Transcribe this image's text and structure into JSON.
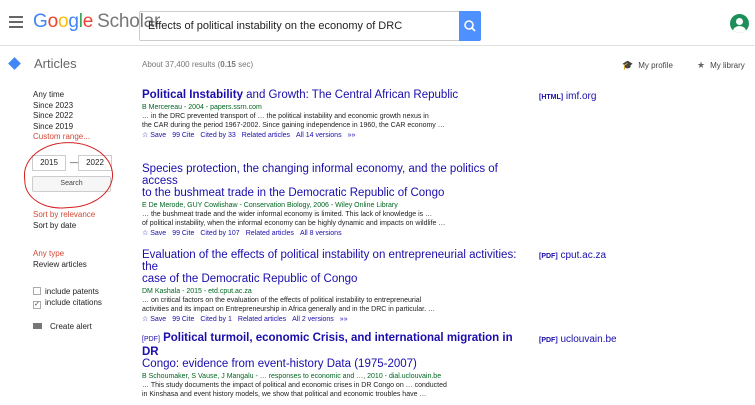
{
  "header": {
    "logo_google": [
      "G",
      "o",
      "o",
      "g",
      "l",
      "e"
    ],
    "logo_scholar": "Scholar",
    "search_value": "Effects of political instability on the economy of DRC"
  },
  "subbar": {
    "section": "Articles",
    "about_prefix": "About 37,400 results (",
    "about_time": "0.15",
    "about_suffix": " sec)",
    "my_profile": "My profile",
    "my_library": "My library"
  },
  "sidebar": {
    "time_filters": [
      "Any time",
      "Since 2023",
      "Since 2022",
      "Since 2019"
    ],
    "custom_range": "Custom range...",
    "year_from": "2015",
    "year_sep": "—",
    "year_to": "2022",
    "search_button": "Search",
    "sort_relevance": "Sort by relevance",
    "sort_date": "Sort by date",
    "any_type": "Any type",
    "review_articles": "Review articles",
    "include_patents": "include patents",
    "include_citations": "include citations",
    "create_alert": "Create alert"
  },
  "results": [
    {
      "title_parts": [
        [
          "Political Instability",
          true
        ],
        [
          " and Growth: The Central African Republic",
          false
        ]
      ],
      "authors": "B Mercereau - 2004 - papers.ssrn.com",
      "snippet1": "… in the DRC prevented transport of … the political instability and economic growth nexus in",
      "snippet2": "the CAR during the period 1967-2002. Since gaining independence in 1960, the CAR economy …",
      "links": [
        "☆ Save",
        "99 Cite",
        "Cited by 33",
        "Related articles",
        "All 14 versions",
        "»»"
      ],
      "side_format": "[HTML]",
      "side_domain": "imf.org"
    },
    {
      "title_line1": "Species protection, the changing informal economy, and the politics of access",
      "title_line2": "to the bushmeat trade in the Democratic Republic of Congo",
      "authors": "E De Merode, GUY Cowlishaw - Conservation Biology, 2006 - Wiley Online Library",
      "snippet1": "… the bushmeat trade and the wider informal economy is limited. This lack of knowledge is …",
      "snippet2": "of political instability, when the informal economy can be highly dynamic and impacts on wildlife …",
      "links": [
        "☆ Save",
        "99 Cite",
        "Cited by 107",
        "Related articles",
        "All 8 versions"
      ]
    },
    {
      "title_line1": "Evaluation of the effects of political instability on entrepreneurial activities: the",
      "title_line2": "case of the Democratic Republic of Congo",
      "authors": "DM Kashala - 2015 - etd.cput.ac.za",
      "snippet1": "… on critical factors on the evaluation of the effects of political instability to entrepreneurial",
      "snippet2": "activities and its impact on Entrepreneurship in Africa generally and in the DRC in particular. …",
      "links": [
        "☆ Save",
        "99 Cite",
        "Cited by 1",
        "Related articles",
        "All 2 versions",
        "»»"
      ],
      "side_format": "[PDF]",
      "side_domain": "cput.ac.za"
    },
    {
      "title_tag": "[PDF]",
      "title_line1": "Political turmoil, economic Crisis, and international migration in DR",
      "title_line2": "Congo: evidence from event-history Data (1975-2007)",
      "authors": "B Schoumaker, S Vause, J Mangalu - … responses to economic and …, 2010 - dial.uclouvain.be",
      "snippet1": "… This study documents the impact of political and economic crises in DR Congo on … conducted",
      "snippet2": "in Kinshasa and event history models, we show that political and economic troubles have …",
      "side_format": "[PDF]",
      "side_domain": "uclouvain.be"
    }
  ]
}
